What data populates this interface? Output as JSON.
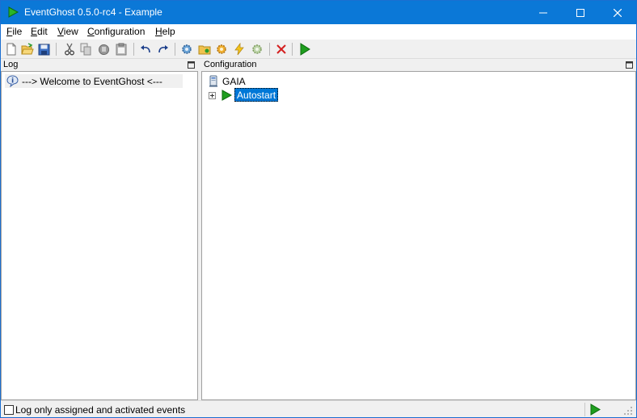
{
  "window": {
    "title": "EventGhost 0.5.0-rc4 - Example"
  },
  "menu": {
    "items": [
      {
        "accel": "F",
        "rest": "ile"
      },
      {
        "accel": "E",
        "rest": "dit"
      },
      {
        "accel": "V",
        "rest": "iew"
      },
      {
        "accel": "C",
        "rest": "onfiguration"
      },
      {
        "accel": "H",
        "rest": "elp"
      }
    ]
  },
  "toolbar": {
    "icons": [
      "new-file-icon",
      "open-folder-icon",
      "save-icon",
      "cut-icon",
      "copy-icon",
      "paste-icon",
      "clipboard-icon",
      "undo-icon",
      "redo-icon",
      "add-plugin-icon",
      "add-folder-icon",
      "add-macro-icon",
      "add-event-icon",
      "add-action-icon",
      "delete-icon",
      "execute-icon"
    ]
  },
  "log": {
    "header": "Log",
    "entries": [
      "---> Welcome to EventGhost <---"
    ]
  },
  "configuration": {
    "header": "Configuration",
    "root": "GAIA",
    "child": "Autostart"
  },
  "status": {
    "checkbox_label": "Log only assigned and activated events",
    "checked": false
  },
  "colors": {
    "titlebar": "#0b78d7",
    "selection": "#0078d7",
    "play_green": "#1e9e1e",
    "delete_red": "#d42020"
  }
}
